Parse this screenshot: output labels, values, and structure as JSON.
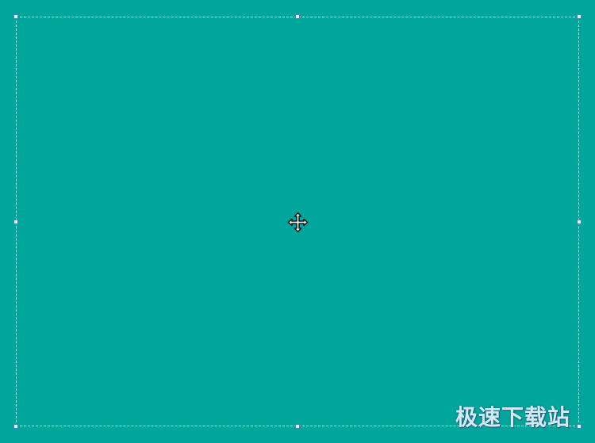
{
  "canvas": {
    "background_color": "#00a69b"
  },
  "selection": {
    "border_color": "#c9ecf0",
    "handle_color": "#3f7fe0"
  },
  "cursor": {
    "icon": "move-cursor-icon"
  },
  "watermark": {
    "text": "极速下载站"
  }
}
